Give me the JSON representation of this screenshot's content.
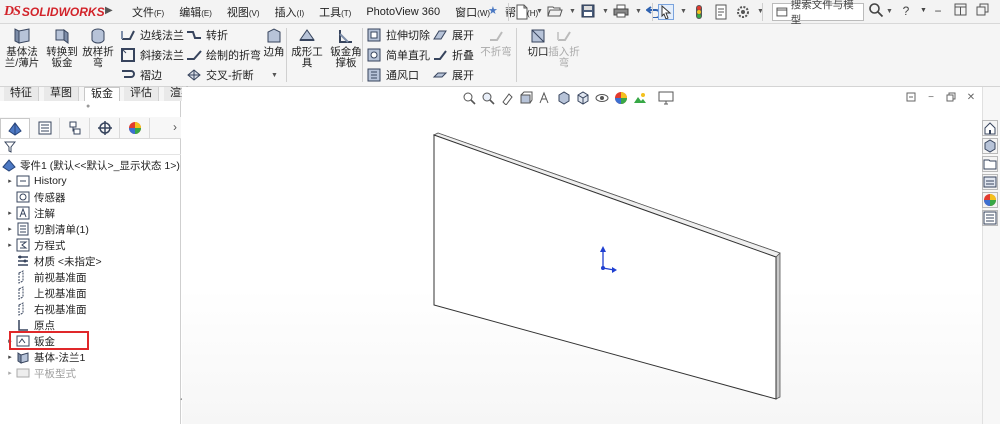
{
  "app": {
    "logo_mark": "DS",
    "logo_text": "SOLIDWORKS",
    "brand_color": "#d2232a"
  },
  "menu": {
    "items": [
      {
        "label": "文件",
        "key": "(F)"
      },
      {
        "label": "编辑",
        "key": "(E)"
      },
      {
        "label": "视图",
        "key": "(V)"
      },
      {
        "label": "插入",
        "key": "(I)"
      },
      {
        "label": "工具",
        "key": "(T)"
      },
      {
        "label": "PhotoView 360",
        "key": ""
      },
      {
        "label": "窗口",
        "key": "(W)"
      },
      {
        "label": "帮助",
        "key": "(H)"
      }
    ]
  },
  "search": {
    "placeholder": "搜索文件与模型"
  },
  "ribbon": {
    "base_flange": "基体法\n兰/薄片",
    "convert_to_sheet": "转换到\n钣金",
    "lofted_bend": "放样折\n弯",
    "edge_flange": "边线法兰",
    "miter_flange": "斜接法兰",
    "hem": "褶边",
    "jog": "转折",
    "sketched_bend": "绘制的折弯",
    "cross_break": "交叉-折断",
    "corners": "边角",
    "forming_tool": "成形工\n具",
    "sheet_metal_gusset": "钣金角\n撑板",
    "extruded_cut": "拉伸切除",
    "simple_hole": "简单直孔",
    "vent": "通风口",
    "unfold": "展开",
    "fold": "折叠",
    "flatten": "展开",
    "no_bends": "不折弯",
    "rip": "切口",
    "insert_bends": "插入折\n弯"
  },
  "tabs": [
    "特征",
    "草图",
    "钣金",
    "评估",
    "渲染工具"
  ],
  "active_tab": "钣金",
  "tree": {
    "root": "零件1 (默认<<默认>_显示状态 1>)",
    "items": [
      {
        "label": "History"
      },
      {
        "label": "传感器"
      },
      {
        "label": "注解"
      },
      {
        "label": "切割清单(1)"
      },
      {
        "label": "方程式"
      },
      {
        "label": "材质 <未指定>"
      },
      {
        "label": "前视基准面"
      },
      {
        "label": "上视基准面"
      },
      {
        "label": "右视基准面"
      },
      {
        "label": "原点"
      },
      {
        "label": "钣金"
      },
      {
        "label": "基体-法兰1"
      },
      {
        "label": "平板型式"
      }
    ],
    "highlight_color": "#e0282a"
  },
  "icons": {
    "pin": "pin-icon",
    "filter": "filter-icon",
    "origin_triad": "triad-icon"
  }
}
